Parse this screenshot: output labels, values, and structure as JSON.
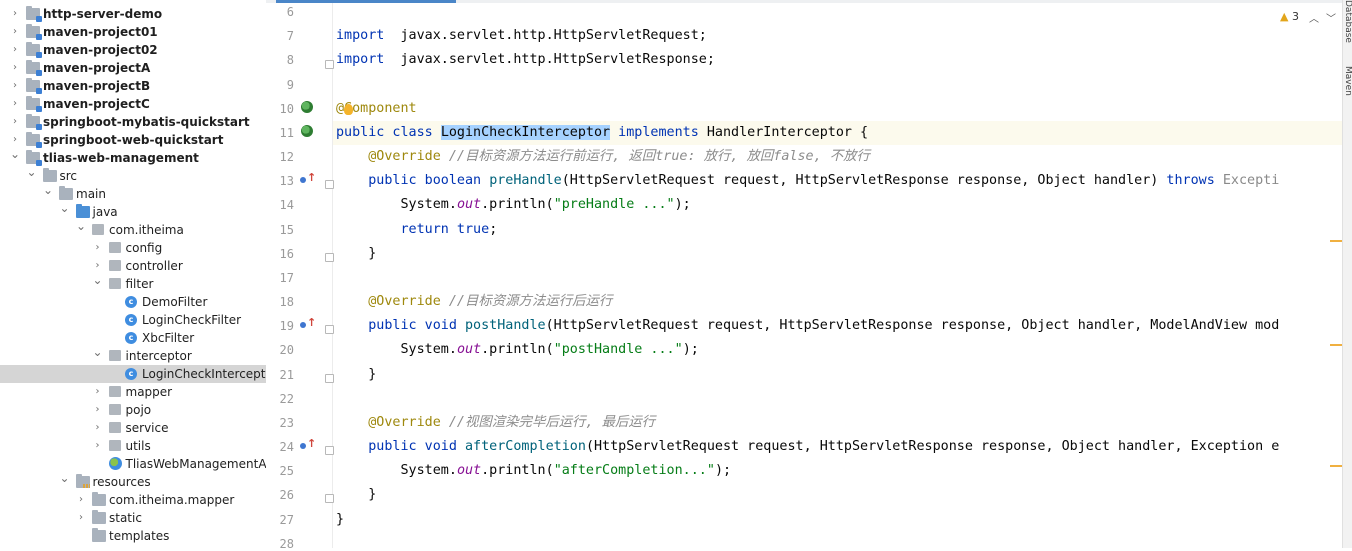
{
  "project_tree": [
    {
      "label": "http-server-demo",
      "depth": 0,
      "arrow": "right",
      "icon": "module-folder-icon",
      "bold": true
    },
    {
      "label": "maven-project01",
      "depth": 0,
      "arrow": "right",
      "icon": "module-folder-icon",
      "bold": true
    },
    {
      "label": "maven-project02",
      "depth": 0,
      "arrow": "right",
      "icon": "module-folder-icon",
      "bold": true
    },
    {
      "label": "maven-projectA",
      "depth": 0,
      "arrow": "right",
      "icon": "module-folder-icon",
      "bold": true
    },
    {
      "label": "maven-projectB",
      "depth": 0,
      "arrow": "right",
      "icon": "module-folder-icon",
      "bold": true
    },
    {
      "label": "maven-projectC",
      "depth": 0,
      "arrow": "right",
      "icon": "module-folder-icon",
      "bold": true
    },
    {
      "label": "springboot-mybatis-quickstart",
      "depth": 0,
      "arrow": "right",
      "icon": "module-folder-icon",
      "bold": true
    },
    {
      "label": "springboot-web-quickstart",
      "depth": 0,
      "arrow": "right",
      "icon": "module-folder-icon",
      "bold": true
    },
    {
      "label": "tlias-web-management",
      "depth": 0,
      "arrow": "down",
      "icon": "module-folder-icon",
      "bold": true
    },
    {
      "label": "src",
      "depth": 1,
      "arrow": "down",
      "icon": "folder-icon",
      "bold": false
    },
    {
      "label": "main",
      "depth": 2,
      "arrow": "down",
      "icon": "folder-icon",
      "bold": false
    },
    {
      "label": "java",
      "depth": 3,
      "arrow": "down",
      "icon": "source-folder-icon",
      "bold": false
    },
    {
      "label": "com.itheima",
      "depth": 4,
      "arrow": "down",
      "icon": "package-icon",
      "bold": false
    },
    {
      "label": "config",
      "depth": 5,
      "arrow": "right",
      "icon": "package-icon",
      "bold": false
    },
    {
      "label": "controller",
      "depth": 5,
      "arrow": "right",
      "icon": "package-icon",
      "bold": false
    },
    {
      "label": "filter",
      "depth": 5,
      "arrow": "down",
      "icon": "package-icon",
      "bold": false
    },
    {
      "label": "DemoFilter",
      "depth": 6,
      "arrow": "",
      "icon": "class-icon",
      "bold": false
    },
    {
      "label": "LoginCheckFilter",
      "depth": 6,
      "arrow": "",
      "icon": "class-icon",
      "bold": false
    },
    {
      "label": "XbcFilter",
      "depth": 6,
      "arrow": "",
      "icon": "class-icon",
      "bold": false
    },
    {
      "label": "interceptor",
      "depth": 5,
      "arrow": "down",
      "icon": "package-icon",
      "bold": false
    },
    {
      "label": "LoginCheckInterceptor",
      "depth": 6,
      "arrow": "",
      "icon": "class-icon",
      "bold": false,
      "selected": true
    },
    {
      "label": "mapper",
      "depth": 5,
      "arrow": "right",
      "icon": "package-icon",
      "bold": false
    },
    {
      "label": "pojo",
      "depth": 5,
      "arrow": "right",
      "icon": "package-icon",
      "bold": false
    },
    {
      "label": "service",
      "depth": 5,
      "arrow": "right",
      "icon": "package-icon",
      "bold": false
    },
    {
      "label": "utils",
      "depth": 5,
      "arrow": "right",
      "icon": "package-icon",
      "bold": false
    },
    {
      "label": "TliasWebManagementApplic",
      "depth": 5,
      "arrow": "",
      "icon": "spring-boot-class-icon",
      "bold": false
    },
    {
      "label": "resources",
      "depth": 3,
      "arrow": "down",
      "icon": "resources-folder-icon",
      "bold": false
    },
    {
      "label": "com.itheima.mapper",
      "depth": 4,
      "arrow": "right",
      "icon": "folder-icon",
      "bold": false
    },
    {
      "label": "static",
      "depth": 4,
      "arrow": "right",
      "icon": "folder-icon",
      "bold": false
    },
    {
      "label": "templates",
      "depth": 4,
      "arrow": "",
      "icon": "folder-icon",
      "bold": false
    }
  ],
  "editor": {
    "current_line": 11,
    "lines": [
      {
        "n": "6",
        "tokens": []
      },
      {
        "n": "7",
        "tokens": [
          [
            "kw",
            "import"
          ],
          [
            "",
            "  javax.servlet.http.HttpServletRequest;"
          ]
        ]
      },
      {
        "n": "8",
        "tokens": [
          [
            "kw",
            "import"
          ],
          [
            "",
            "  javax.servlet.http.HttpServletResponse;"
          ]
        ]
      },
      {
        "n": "9",
        "tokens": []
      },
      {
        "n": "10",
        "tokens": [
          [
            "an",
            "@Component"
          ]
        ]
      },
      {
        "n": "11",
        "tokens": [
          [
            "kw",
            "public class "
          ],
          [
            "hl",
            "LoginCheckInterceptor"
          ],
          [
            "kw",
            " implements "
          ],
          [
            "",
            "HandlerInterceptor {"
          ]
        ]
      },
      {
        "n": "12",
        "tokens": [
          [
            "",
            "    "
          ],
          [
            "an",
            "@Override"
          ],
          [
            "cm",
            " //目标资源方法运行前运行, 返回true: 放行, 放回false, 不放行"
          ]
        ]
      },
      {
        "n": "13",
        "tokens": [
          [
            "",
            "    "
          ],
          [
            "kw",
            "public boolean "
          ],
          [
            "me",
            "preHandle"
          ],
          [
            "",
            "(HttpServletRequest request, HttpServletResponse response, Object handler) "
          ],
          [
            "kw",
            "throws "
          ],
          [
            "dim",
            "Excepti"
          ]
        ]
      },
      {
        "n": "14",
        "tokens": [
          [
            "",
            "        System."
          ],
          [
            "fi",
            "out"
          ],
          [
            "",
            ".println("
          ],
          [
            "st",
            "\"preHandle ...\""
          ],
          [
            "",
            ");"
          ]
        ]
      },
      {
        "n": "15",
        "tokens": [
          [
            "",
            "        "
          ],
          [
            "kw",
            "return true"
          ],
          [
            "",
            ";"
          ]
        ]
      },
      {
        "n": "16",
        "tokens": [
          [
            "",
            "    }"
          ]
        ]
      },
      {
        "n": "17",
        "tokens": []
      },
      {
        "n": "18",
        "tokens": [
          [
            "",
            "    "
          ],
          [
            "an",
            "@Override"
          ],
          [
            "cm",
            " //目标资源方法运行后运行"
          ]
        ]
      },
      {
        "n": "19",
        "tokens": [
          [
            "",
            "    "
          ],
          [
            "kw",
            "public void "
          ],
          [
            "me",
            "postHandle"
          ],
          [
            "",
            "(HttpServletRequest request, HttpServletResponse response, Object handler, ModelAndView mod"
          ]
        ]
      },
      {
        "n": "20",
        "tokens": [
          [
            "",
            "        System."
          ],
          [
            "fi",
            "out"
          ],
          [
            "",
            ".println("
          ],
          [
            "st",
            "\"postHandle ...\""
          ],
          [
            "",
            ");"
          ]
        ]
      },
      {
        "n": "21",
        "tokens": [
          [
            "",
            "    }"
          ]
        ]
      },
      {
        "n": "22",
        "tokens": []
      },
      {
        "n": "23",
        "tokens": [
          [
            "",
            "    "
          ],
          [
            "an",
            "@Override"
          ],
          [
            "cm",
            " //视图渲染完毕后运行, 最后运行"
          ]
        ]
      },
      {
        "n": "24",
        "tokens": [
          [
            "",
            "    "
          ],
          [
            "kw",
            "public void "
          ],
          [
            "me",
            "afterCompletion"
          ],
          [
            "",
            "(HttpServletRequest request, HttpServletResponse response, Object handler, Exception e"
          ]
        ]
      },
      {
        "n": "25",
        "tokens": [
          [
            "",
            "        System."
          ],
          [
            "fi",
            "out"
          ],
          [
            "",
            ".println("
          ],
          [
            "st",
            "\"afterCompletion...\""
          ],
          [
            "",
            ");"
          ]
        ]
      },
      {
        "n": "26",
        "tokens": [
          [
            "",
            "    }"
          ]
        ]
      },
      {
        "n": "27",
        "tokens": [
          [
            "",
            "}"
          ]
        ]
      },
      {
        "n": "28",
        "tokens": []
      }
    ]
  },
  "inspections": {
    "warning_count": "3"
  },
  "side_tabs": [
    "Database",
    "Maven"
  ],
  "colors": {
    "keyword": "#0033b3",
    "annotation": "#9e880d",
    "comment": "#8c8c8c",
    "string": "#067d17",
    "field": "#871094",
    "method": "#00627a",
    "highlight": "#a6d2ff",
    "selection": "#d5d5d5"
  }
}
